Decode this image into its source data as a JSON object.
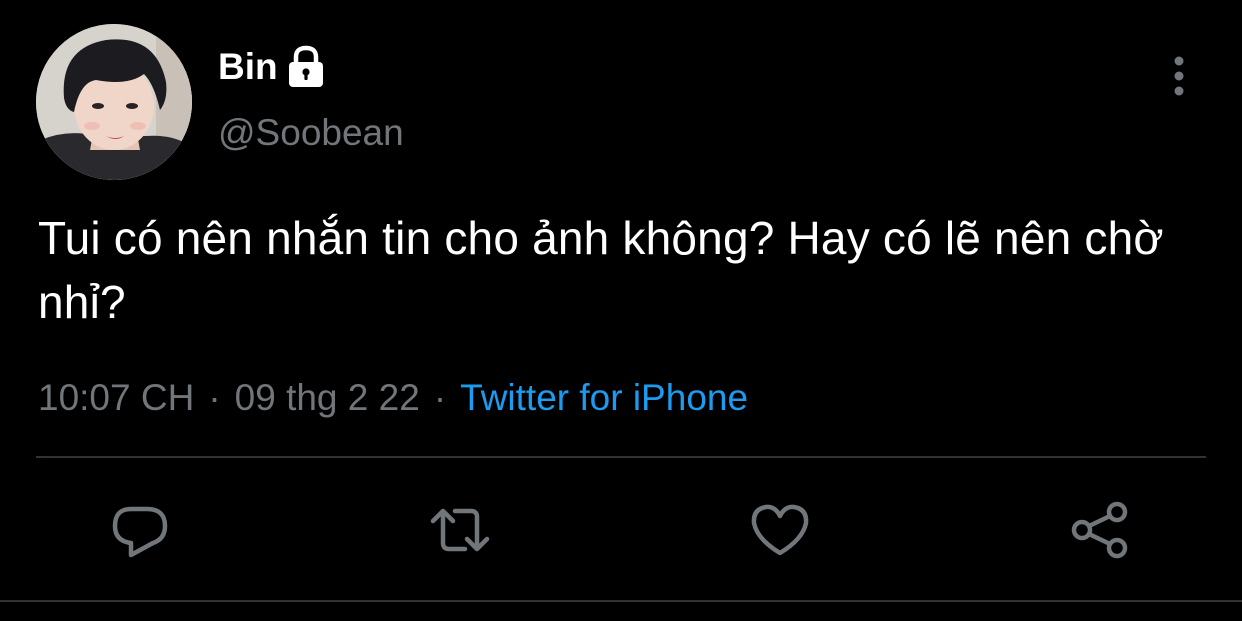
{
  "user": {
    "display_name": "Bin",
    "handle": "@Soobean",
    "protected_icon": "lock-icon",
    "avatar": "profile-photo"
  },
  "tweet": {
    "text": "Tui có nên nhắn tin cho ảnh không? Hay có lẽ nên chờ nhỉ?",
    "time": "10:07 CH",
    "separator": "·",
    "date": "09 thg 2 22",
    "source": "Twitter for iPhone"
  },
  "header": {
    "more_icon": "more-vertical-icon"
  },
  "actions": [
    {
      "name": "reply",
      "icon": "reply-icon"
    },
    {
      "name": "retweet",
      "icon": "retweet-icon"
    },
    {
      "name": "like",
      "icon": "heart-icon"
    },
    {
      "name": "share",
      "icon": "share-icon"
    }
  ],
  "colors": {
    "background": "#000000",
    "text_primary": "#ffffff",
    "text_muted": "#71767b",
    "link": "#1d9bf0",
    "divider": "#2f3336"
  }
}
